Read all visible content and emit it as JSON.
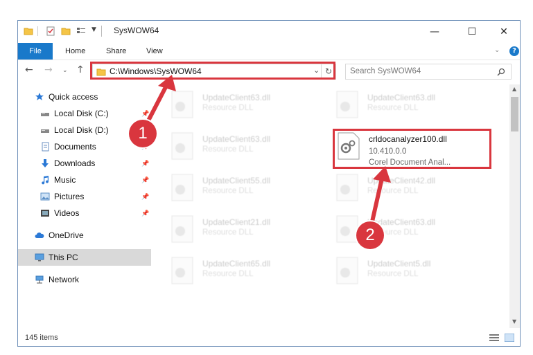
{
  "window": {
    "title": "SysWOW64",
    "controls": {
      "minimize": "—",
      "maximize": "☐",
      "close": "✕"
    }
  },
  "ribbon": {
    "tabs": [
      "File",
      "Home",
      "Share",
      "View"
    ],
    "help": "?"
  },
  "navigation": {
    "address": "C:\\Windows\\SysWOW64",
    "search_placeholder": "Search SysWOW64"
  },
  "sidebar": {
    "items": [
      {
        "label": "Quick access",
        "icon": "star-icon",
        "pinned": false
      },
      {
        "label": "Local Disk (C:)",
        "icon": "drive-icon",
        "pinned": true
      },
      {
        "label": "Local Disk (D:)",
        "icon": "drive-icon",
        "pinned": true
      },
      {
        "label": "Documents",
        "icon": "documents-icon",
        "pinned": true
      },
      {
        "label": "Downloads",
        "icon": "downloads-icon",
        "pinned": true
      },
      {
        "label": "Music",
        "icon": "music-icon",
        "pinned": true
      },
      {
        "label": "Pictures",
        "icon": "pictures-icon",
        "pinned": true
      },
      {
        "label": "Videos",
        "icon": "videos-icon",
        "pinned": true
      },
      {
        "label": "OneDrive",
        "icon": "cloud-icon",
        "pinned": false
      },
      {
        "label": "This PC",
        "icon": "computer-icon",
        "pinned": false,
        "selected": true
      },
      {
        "label": "Network",
        "icon": "network-icon",
        "pinned": false
      }
    ]
  },
  "files": {
    "background": [
      {
        "name": "UpdateClient63.dll",
        "type": "Resource DLL"
      },
      {
        "name": "UpdateClient63.dll",
        "type": "Resource DLL"
      },
      {
        "name": "UpdateClient63.dll",
        "type": "Resource DLL"
      },
      {
        "name": "UpdateClient55.dll",
        "type": "Resource DLL"
      },
      {
        "name": "UpdateClient42.dll",
        "type": "Resource DLL"
      },
      {
        "name": "UpdateClient21.dll",
        "type": "Resource DLL"
      },
      {
        "name": "UpdateClient63.dll",
        "type": "Resource DLL"
      },
      {
        "name": "UpdateClient65.dll",
        "type": "Resource DLL"
      },
      {
        "name": "UpdateClient5.dll",
        "type": "Resource DLL"
      }
    ],
    "highlighted": {
      "name": "crldocanalyzer100.dll",
      "version": "10.410.0.0",
      "description": "Corel Document Anal..."
    }
  },
  "status": {
    "items": "145 items"
  },
  "annotations": {
    "step1": "1",
    "step2": "2",
    "color": "#d9363e"
  }
}
